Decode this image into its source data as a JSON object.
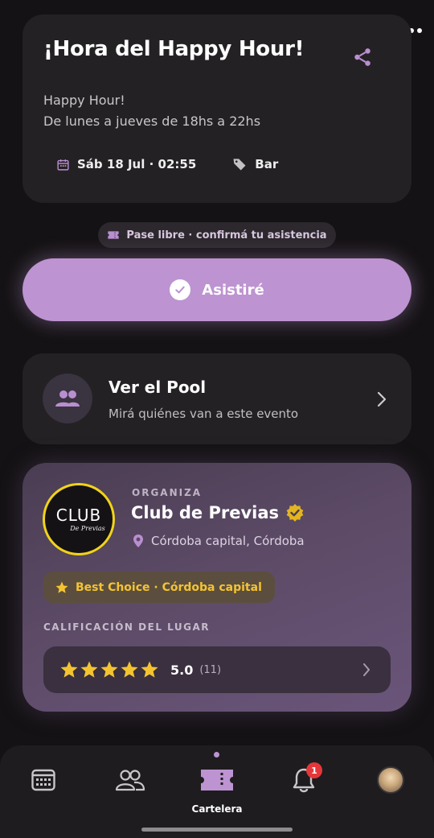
{
  "event": {
    "title": "¡Hora del Happy Hour!",
    "description_line1": "Happy Hour!",
    "description_line2": "De lunes a jueves de 18hs a 22hs",
    "datetime": "Sáb 18 Jul · 02:55",
    "category": "Bar"
  },
  "pase": {
    "label": "Pase libre · confirmá tu asistencia"
  },
  "attend_button": {
    "label": "Asistiré"
  },
  "pool": {
    "title": "Ver el Pool",
    "subtitle": "Mirá quiénes van a este evento"
  },
  "organizer": {
    "section_label": "ORGANIZA",
    "logo_text": "CLUB",
    "logo_subtext": "De Previas",
    "name": "Club de Previas",
    "location": "Córdoba capital, Córdoba",
    "badge": "Best Choice · Córdoba capital",
    "rating_label": "CALIFICACIÓN DEL LUGAR",
    "rating_stars": 5,
    "rating_score": "5.0",
    "rating_count": "(11)"
  },
  "nav": {
    "active_label": "Cartelera",
    "notification_count": "1"
  },
  "colors": {
    "accent": "#bd93d1",
    "background": "#141214",
    "card": "#242124",
    "star": "#f4c430",
    "notification": "#e5373b"
  }
}
